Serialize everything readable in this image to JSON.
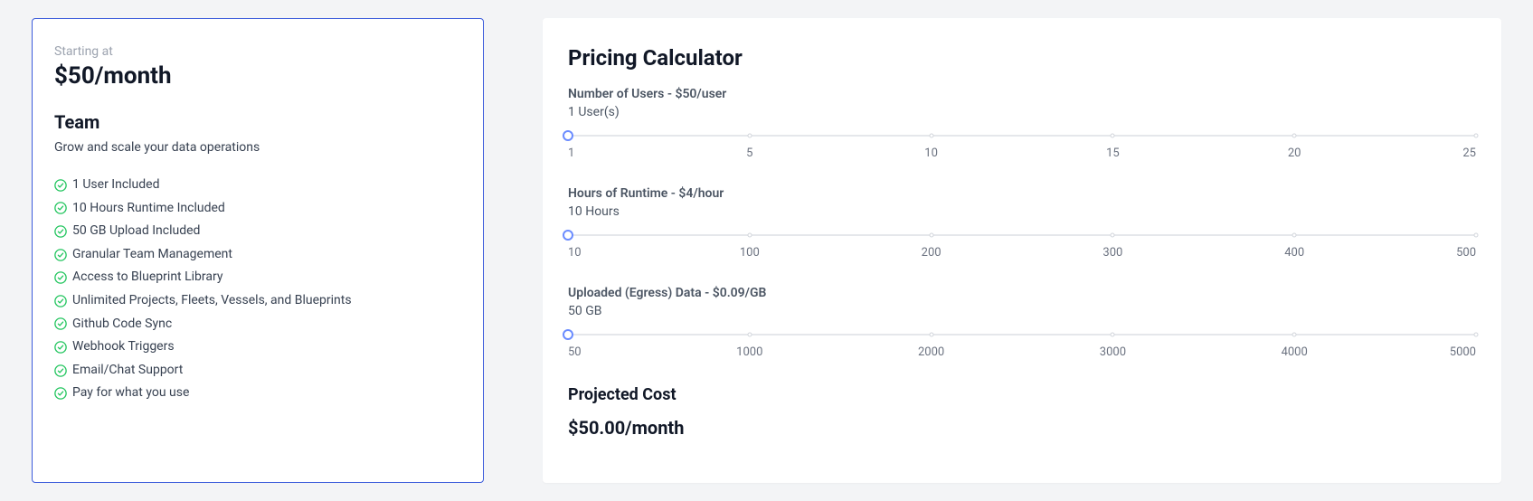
{
  "plan": {
    "starting_at": "Starting at",
    "price": "$50/month",
    "name": "Team",
    "desc": "Grow and scale your data operations",
    "features": [
      "1 User Included",
      "10 Hours Runtime Included",
      "50 GB Upload Included",
      "Granular Team Management",
      "Access to Blueprint Library",
      "Unlimited Projects, Fleets, Vessels, and Blueprints",
      "Github Code Sync",
      "Webhook Triggers",
      "Email/Chat Support",
      "Pay for what you use"
    ]
  },
  "calculator": {
    "title": "Pricing Calculator",
    "users": {
      "label": "Number of Users - $50/user",
      "value": "1 User(s)",
      "marks": [
        "1",
        "5",
        "10",
        "15",
        "20",
        "25"
      ]
    },
    "runtime": {
      "label": "Hours of Runtime - $4/hour",
      "value": "10 Hours",
      "marks": [
        "10",
        "100",
        "200",
        "300",
        "400",
        "500"
      ]
    },
    "data": {
      "label": "Uploaded (Egress) Data - $0.09/GB",
      "value": "50 GB",
      "marks": [
        "50",
        "1000",
        "2000",
        "3000",
        "4000",
        "5000"
      ]
    },
    "projected_label": "Projected Cost",
    "projected_value": "$50.00/month"
  }
}
